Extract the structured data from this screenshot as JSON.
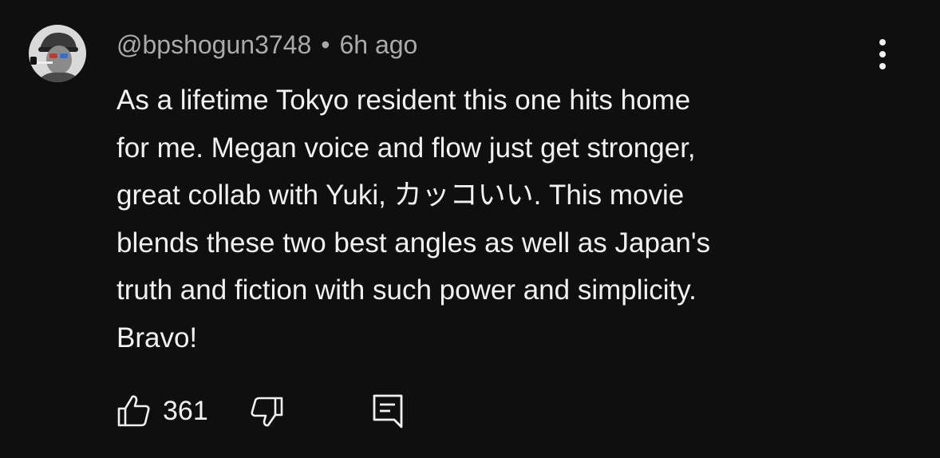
{
  "comment": {
    "username": "@bpshogun3748",
    "separator": "•",
    "time": "6h ago",
    "body_lines": [
      "As a lifetime Tokyo resident this one hits home",
      "for me. Megan voice and flow just get stronger,",
      "great collab with Yuki, カッコいい. This movie",
      "blends these two best angles as well as Japan's",
      "truth and fiction with such power and simplicity.",
      "Bravo!"
    ],
    "like_count": "361"
  },
  "icons": {
    "avatar": "avatar-image",
    "menu": "more-vertical-icon",
    "like": "thumb-up-icon",
    "dislike": "thumb-down-icon",
    "reply": "reply-comment-icon"
  },
  "colors": {
    "background": "#0f0f0f",
    "primary_text": "#f1f1f1",
    "secondary_text": "#aaaaaa"
  }
}
